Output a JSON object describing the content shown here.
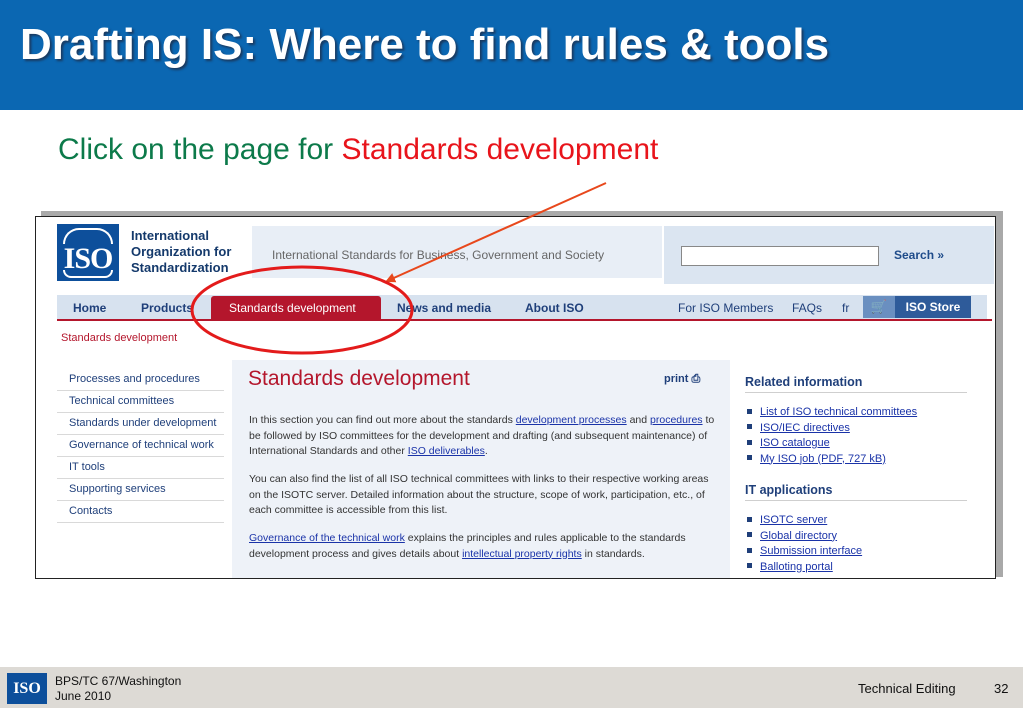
{
  "slide": {
    "title": "Drafting IS: Where to find rules & tools",
    "subtitle_part1": "Click on the page for ",
    "subtitle_part2": "Standards development"
  },
  "site": {
    "logo_text": "ISO",
    "org_name": "International\nOrganization for\nStandardization",
    "tagline": "International Standards for Business, Government and Society",
    "search_label": "Search »",
    "nav": {
      "home": "Home",
      "products": "Products",
      "standards_development": "Standards development",
      "news_and_media": "News and media",
      "about_iso": "About ISO",
      "for_iso_members": "For ISO Members",
      "faqs": "FAQs",
      "fr": "fr",
      "cart_icon": "cart-icon",
      "iso_store": "ISO Store"
    },
    "breadcrumb": "Standards development",
    "left_nav": [
      "Processes and procedures",
      "Technical committees",
      "Standards under development",
      "Governance of technical work",
      "IT tools",
      "Supporting services",
      "Contacts"
    ],
    "main": {
      "title": "Standards development",
      "print_label": "print",
      "p1_a": "In this section you can find out more about the standards ",
      "p1_link1": "development processes",
      "p1_b": " and ",
      "p1_link2": "procedures",
      "p1_c": " to be followed by ISO committees for the development and drafting (and subsequent maintenance) of International Standards and other ",
      "p1_link3": "ISO deliverables",
      "p1_d": ".",
      "p2": "You can also find the list of all ISO technical committees with links to their respective working areas on the ISOTC server. Detailed information about the structure, scope of work, participation, etc., of each committee is accessible from this list.",
      "p3_link1": "Governance of the technical work",
      "p3_a": " explains the principles and rules applicable to the standards development process and gives details about ",
      "p3_link2": "intellectual property rights",
      "p3_b": " in standards."
    },
    "related": {
      "heading": "Related information",
      "items": [
        "List of ISO technical committees",
        "ISO/IEC directives",
        "ISO catalogue",
        "My ISO job  (PDF, 727 kB)"
      ]
    },
    "it_apps": {
      "heading": "IT applications",
      "items": [
        "ISOTC server",
        "Global directory",
        "Submission interface",
        "Balloting portal"
      ]
    }
  },
  "footer": {
    "logo_text": "ISO",
    "line1": "BPS/TC 67/Washington",
    "line2": "June 2010",
    "right_text": "Technical Editing",
    "page_number": "32"
  },
  "colors": {
    "title_bar": "#0b67b2",
    "subtitle_green": "#0c7a4a",
    "subtitle_red": "#e8141b",
    "iso_red": "#b4162c",
    "annotation_red": "#e31b1b",
    "arrow_orange": "#e8481c"
  }
}
